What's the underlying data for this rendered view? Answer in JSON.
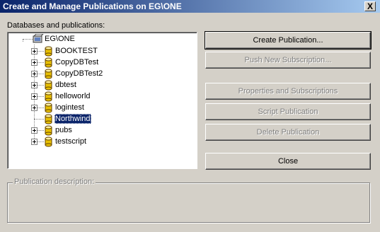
{
  "window": {
    "title": "Create and Manage Publications on EG\\ONE",
    "close_glyph": "X"
  },
  "tree": {
    "label": "Databases and publications:",
    "root": {
      "label": "EG\\ONE",
      "icon": "server-icon"
    },
    "items": [
      {
        "label": "BOOKTEST",
        "expandable": true,
        "selected": false
      },
      {
        "label": "CopyDBTest",
        "expandable": true,
        "selected": false
      },
      {
        "label": "CopyDBTest2",
        "expandable": true,
        "selected": false
      },
      {
        "label": "dbtest",
        "expandable": true,
        "selected": false
      },
      {
        "label": "helloworld",
        "expandable": true,
        "selected": false
      },
      {
        "label": "logintest",
        "expandable": true,
        "selected": false
      },
      {
        "label": "Northwind",
        "expandable": false,
        "selected": true
      },
      {
        "label": "pubs",
        "expandable": true,
        "selected": false
      },
      {
        "label": "testscript",
        "expandable": true,
        "selected": false
      }
    ]
  },
  "buttons": {
    "create": {
      "label": "Create Publication...",
      "enabled": true
    },
    "push": {
      "label": "Push New Subscription...",
      "enabled": false
    },
    "properties": {
      "label": "Properties and Subscriptions",
      "enabled": false
    },
    "script": {
      "label": "Script Publication",
      "enabled": false
    },
    "delete": {
      "label": "Delete Publication",
      "enabled": false
    },
    "close": {
      "label": "Close",
      "enabled": true
    }
  },
  "description": {
    "label": "Publication description:",
    "text": ""
  },
  "colors": {
    "title_start": "#0a246a",
    "title_end": "#a6caf0",
    "dialog_bg": "#d4d0c8",
    "selection": "#0a246a",
    "db_icon": "#e8c000"
  }
}
